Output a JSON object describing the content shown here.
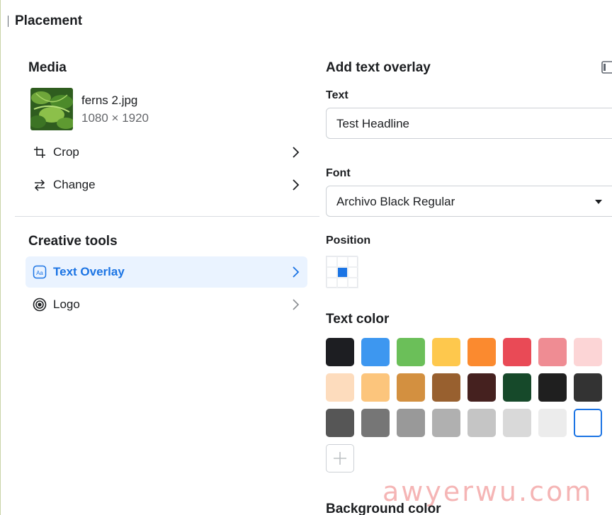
{
  "header": {
    "title": "Placement"
  },
  "media": {
    "title": "Media",
    "file_name": "ferns 2.jpg",
    "dimensions": "1080 × 1920",
    "actions": [
      {
        "label": "Crop",
        "icon": "crop-icon"
      },
      {
        "label": "Change",
        "icon": "swap-icon"
      }
    ]
  },
  "creative_tools": {
    "title": "Creative tools",
    "items": [
      {
        "label": "Text Overlay",
        "icon": "text-overlay-icon",
        "active": true
      },
      {
        "label": "Logo",
        "icon": "logo-icon",
        "active": false
      }
    ]
  },
  "overlay": {
    "title": "Add text overlay",
    "text_label": "Text",
    "text_value": "Test Headline",
    "font_label": "Font",
    "font_value": "Archivo Black Regular",
    "position_label": "Position",
    "position_selected": {
      "row": 1,
      "col": 1
    },
    "text_color_label": "Text color",
    "colors": [
      "#1d1e22",
      "#3d97f0",
      "#6bbf59",
      "#fec84d",
      "#fb8a2f",
      "#e94a56",
      "#ef8c93",
      "#fcd5d6",
      "#fddcbd",
      "#fcc57c",
      "#d39040",
      "#98602f",
      "#45211f",
      "#16492a",
      "#1f1f1f",
      "#333333",
      "#565656",
      "#767676",
      "#999999",
      "#b0b0b0",
      "#c5c5c5",
      "#d9d9d9",
      "#ececec",
      "#ffffff"
    ],
    "selected_color_index": 23,
    "background_color_label": "Background color"
  },
  "watermark": "awyerwu.com",
  "theme": {
    "accent": "#1b74e4",
    "active_bg": "#eaf3ff"
  }
}
